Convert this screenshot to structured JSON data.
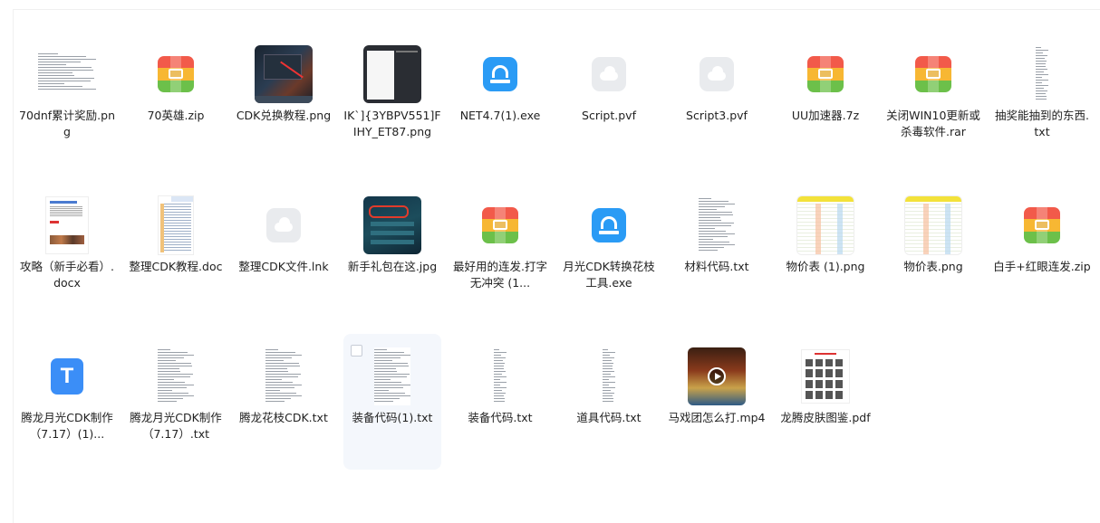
{
  "files": [
    {
      "name": "70dnf累计奖励.png",
      "type": "image-text"
    },
    {
      "name": "70英雄.zip",
      "type": "zip"
    },
    {
      "name": "CDK兑换教程.png",
      "type": "image-dark"
    },
    {
      "name": "IK`]{3YBPV551]FIHY_ET87.png",
      "type": "image-menu"
    },
    {
      "name": "NET4.7(1).exe",
      "type": "exe"
    },
    {
      "name": "Script.pvf",
      "type": "cloud"
    },
    {
      "name": "Script3.pvf",
      "type": "cloud"
    },
    {
      "name": "UU加速器.7z",
      "type": "zip"
    },
    {
      "name": "关闭WIN10更新或杀毒软件.rar",
      "type": "zip"
    },
    {
      "name": "抽奖能抽到的东西.txt",
      "type": "txt-narrow"
    },
    {
      "name": "攻略（新手必看）.docx",
      "type": "docx"
    },
    {
      "name": "整理CDK教程.doc",
      "type": "doc"
    },
    {
      "name": "整理CDK文件.lnk",
      "type": "cloud"
    },
    {
      "name": "新手礼包在这.jpg",
      "type": "image-game"
    },
    {
      "name": "最好用的连发.打字无冲突 (1...",
      "type": "zip"
    },
    {
      "name": "月光CDK转换花枝工具.exe",
      "type": "exe"
    },
    {
      "name": "材料代码.txt",
      "type": "txt"
    },
    {
      "name": "物价表 (1).png",
      "type": "image-sheet"
    },
    {
      "name": "物价表.png",
      "type": "image-sheet"
    },
    {
      "name": "白手+红眼连发.zip",
      "type": "zip"
    },
    {
      "name": "腾龙月光CDK制作（7.17）(1)...",
      "type": "t"
    },
    {
      "name": "腾龙月光CDK制作（7.17）.txt",
      "type": "txt"
    },
    {
      "name": "腾龙花枝CDK.txt",
      "type": "txt"
    },
    {
      "name": "装备代码(1).txt",
      "type": "txt",
      "selected": true
    },
    {
      "name": "装备代码.txt",
      "type": "txt-narrow"
    },
    {
      "name": "道具代码.txt",
      "type": "txt-narrow"
    },
    {
      "name": "马戏团怎么打.mp4",
      "type": "video"
    },
    {
      "name": "龙腾皮肤图鉴.pdf",
      "type": "pdf"
    }
  ],
  "colors": {
    "accent": "#2a9bf5",
    "selected_bg": "#f4f7fc"
  }
}
